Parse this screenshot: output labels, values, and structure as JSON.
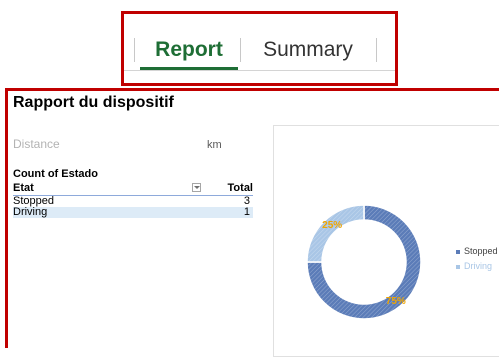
{
  "tabs": [
    {
      "label": "Report",
      "active": true
    },
    {
      "label": "Summary",
      "active": false
    }
  ],
  "report": {
    "title": "Rapport du dispositif",
    "distance_label": "Distance",
    "distance_unit": "km"
  },
  "pivot": {
    "measure": "Count of Estado",
    "row_header": "Etat",
    "total_header": "Total",
    "rows": [
      {
        "label": "Stopped",
        "value": "3"
      },
      {
        "label": "Driving",
        "value": "1"
      }
    ]
  },
  "chart_data": {
    "type": "pie",
    "categories": [
      "Stopped",
      "Driving"
    ],
    "values": [
      3,
      1
    ],
    "labels": [
      "75%",
      "25%"
    ],
    "colors": [
      "#5b7cb8",
      "#a9c6e6"
    ],
    "label_color": "#f0a500",
    "legend_position": "right",
    "donut": true
  }
}
